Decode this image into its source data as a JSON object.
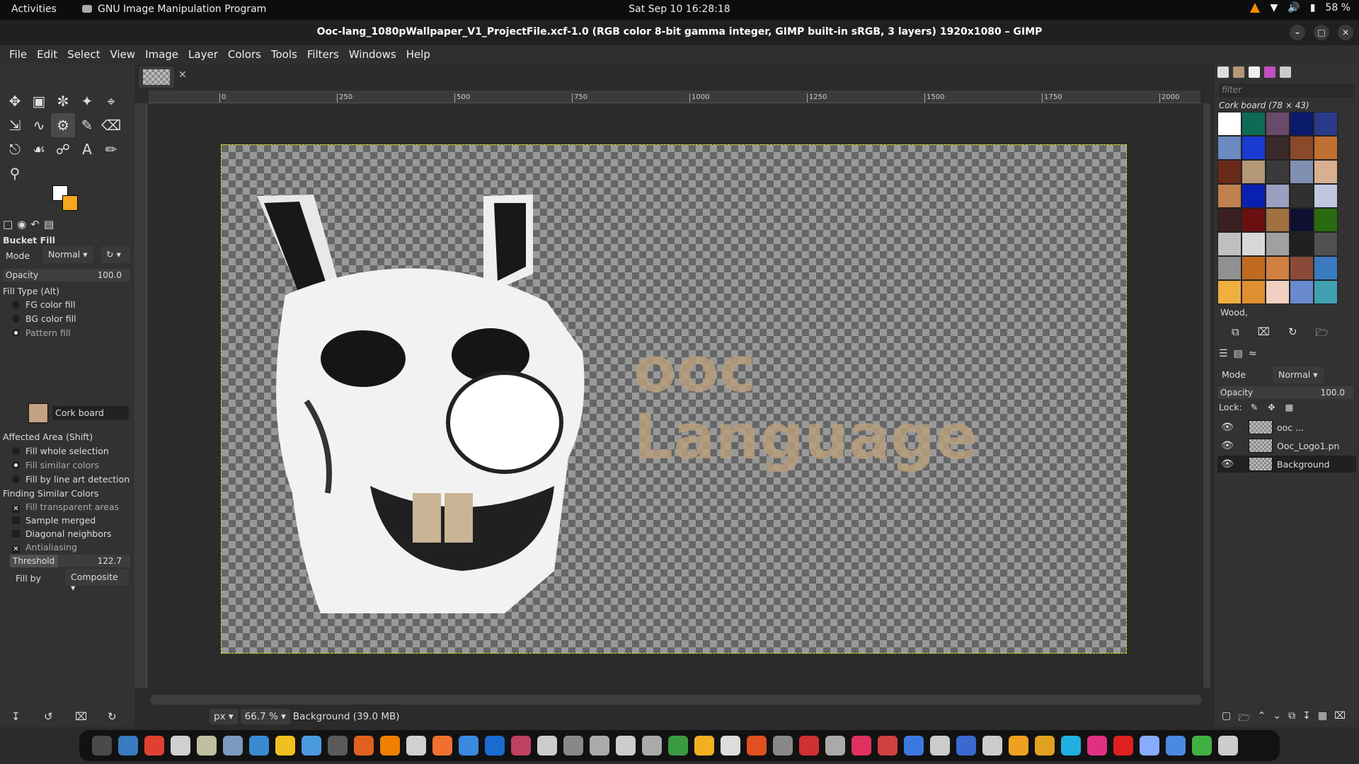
{
  "topbar": {
    "activities": "Activities",
    "app_name": "GNU Image Manipulation Program",
    "clock": "Sat Sep 10  16:28:18",
    "battery": "58 %"
  },
  "window": {
    "title": "Ooc-lang_1080pWallpaper_V1_ProjectFile.xcf-1.0 (RGB color 8-bit gamma integer, GIMP built-in sRGB, 3 layers) 1920x1080 – GIMP"
  },
  "menu": [
    "File",
    "Edit",
    "Select",
    "View",
    "Image",
    "Layer",
    "Colors",
    "Tools",
    "Filters",
    "Windows",
    "Help"
  ],
  "tool_options": {
    "title": "Bucket Fill",
    "mode_label": "Mode",
    "mode_value": "Normal",
    "opacity_label": "Opacity",
    "opacity_value": "100.0",
    "fill_type_label": "Fill Type  (Alt)",
    "fill_types": [
      "FG color fill",
      "BG color fill",
      "Pattern fill"
    ],
    "pattern_name": "Cork board",
    "affected_label": "Affected Area  (Shift)",
    "affected": [
      "Fill whole selection",
      "Fill similar colors",
      "Fill by line art detection"
    ],
    "finding_label": "Finding Similar Colors",
    "finding": [
      "Fill transparent areas",
      "Sample merged",
      "Diagonal neighbors",
      "Antialiasing"
    ],
    "threshold_label": "Threshold",
    "threshold_value": "122.7",
    "fill_by_label": "Fill by",
    "fill_by_value": "Composite"
  },
  "ruler_ticks": [
    "0",
    "250",
    "500",
    "750",
    "1000",
    "1250",
    "1500",
    "1750",
    "2000"
  ],
  "canvas": {
    "text_line1": "ooc",
    "text_line2": "Language"
  },
  "status": {
    "unit": "px",
    "zoom": "66.7 %",
    "layer_info": "Background (39.0 MB)"
  },
  "patterns": {
    "filter_placeholder": "filter",
    "current": "Cork board (78 × 43)",
    "brush_name": "Wood,",
    "colors": [
      "#ffffff",
      "#0e6b55",
      "#6a4a6a",
      "#0a1a6a",
      "#2a3a8a",
      "#6a8ac0",
      "#1a3ad0",
      "#3a2a2a",
      "#8a4a2a",
      "#c07030",
      "#6a2a1a",
      "#b49878",
      "#3a3a3a",
      "#8090b0",
      "#d8b090",
      "#c08050",
      "#0a20b0",
      "#9aa0c0",
      "#303030",
      "#c0c8e0",
      "#3a2020",
      "#6a1010",
      "#a07040",
      "#101030",
      "#2a6a10",
      "#c0c0c0",
      "#d8d8d8",
      "#a0a0a0",
      "#202020",
      "#505050",
      "#909090",
      "#c06a20",
      "#d08040",
      "#8a4a3a",
      "#3a7ac0",
      "#f0b040",
      "#e09030",
      "#f0d0c0",
      "#6a8ad0",
      "#40a0b0"
    ]
  },
  "layers": {
    "mode_label": "Mode",
    "mode_value": "Normal",
    "opacity_label": "Opacity",
    "opacity_value": "100.0",
    "lock_label": "Lock:",
    "items": [
      "ooc ...",
      "Ooc_Logo1.pn",
      "Background"
    ]
  },
  "dock_apps": [
    "#4a4a4a",
    "#3a7ac0",
    "#e04030",
    "#d0d0d0",
    "#c0c0a0",
    "#7a9ac0",
    "#3a8ad0",
    "#f0c020",
    "#4a9ae0",
    "#5a5a5a",
    "#e06020",
    "#f08000",
    "#d0d0d0",
    "#f07030",
    "#3a8ae0",
    "#1a6ad0",
    "#c04060",
    "#cccccc",
    "#888888",
    "#aaaaaa",
    "#cccccc",
    "#aaaaaa",
    "#3a9a40",
    "#f0b020",
    "#dddddd",
    "#e05020",
    "#888888",
    "#d03030",
    "#aaaaaa",
    "#e03060",
    "#d04040",
    "#3a7ae0",
    "#cccccc",
    "#3a6ad0",
    "#cccccc",
    "#f0a020",
    "#e0a020",
    "#20b0e0",
    "#e03080",
    "#e02020",
    "#88aaff",
    "#4a8ae0",
    "#40b040",
    "#cccccc"
  ]
}
